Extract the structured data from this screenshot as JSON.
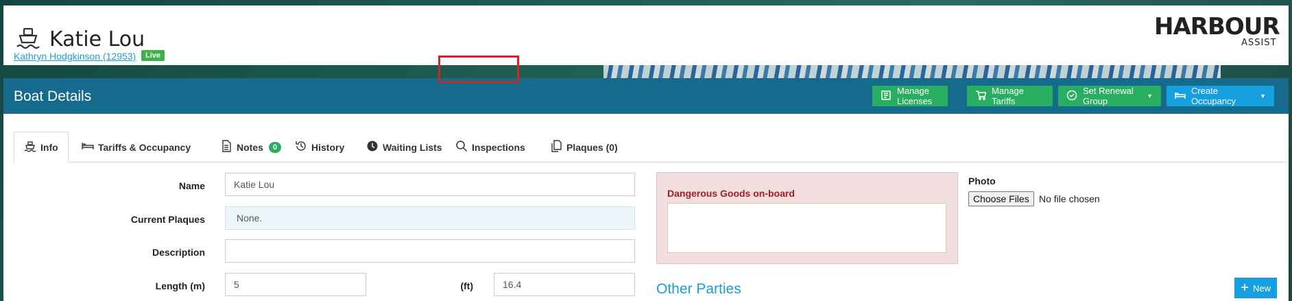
{
  "header": {
    "boat_icon": "boat-icon",
    "title": "Katie Lou",
    "owner_link": "Kathryn Hodgkinson (12953)",
    "status_badge": "Live",
    "logo_main": "HARBOUR",
    "logo_sub": "ASSIST"
  },
  "panel": {
    "title": "Boat Details",
    "buttons": [
      {
        "label": "Manage Licenses",
        "icon": "license-icon"
      },
      {
        "label": "Manage Tariffs",
        "icon": "cart-icon"
      },
      {
        "label": "Set Renewal Group",
        "icon": "check-circle-icon",
        "dropdown": true
      },
      {
        "label": "Create Occupancy",
        "icon": "bed-icon",
        "dropdown": true
      }
    ]
  },
  "tabs": [
    {
      "label": "Info",
      "icon": "boat-icon",
      "active": true
    },
    {
      "label": "Tariffs & Occupancy",
      "icon": "bed-icon"
    },
    {
      "label": "Notes",
      "icon": "document-icon",
      "badge": "0"
    },
    {
      "label": "History",
      "icon": "history-icon"
    },
    {
      "label": "Waiting Lists",
      "icon": "clock-icon"
    },
    {
      "label": "Inspections",
      "icon": "search-icon"
    },
    {
      "label": "Plaques (0)",
      "icon": "copy-icon"
    }
  ],
  "form": {
    "name_label": "Name",
    "name_value": "Katie Lou",
    "plaques_label": "Current Plaques",
    "plaques_value": "None.",
    "description_label": "Description",
    "description_value": "",
    "length_label": "Length (m)",
    "length_value": "5",
    "ft_label": "(ft)",
    "ft_value": "16.4"
  },
  "dangerous_goods": {
    "label": "Dangerous Goods on-board",
    "value": ""
  },
  "photo": {
    "label": "Photo",
    "button": "Choose Files",
    "status": "No file chosen"
  },
  "other_parties": {
    "title": "Other Parties",
    "new_button": "New"
  },
  "colors": {
    "panel_header": "#166a8c",
    "green_button": "#27ae60",
    "blue_button": "#159ee0",
    "highlight": "#d2232a",
    "link": "#1a9fd6"
  }
}
